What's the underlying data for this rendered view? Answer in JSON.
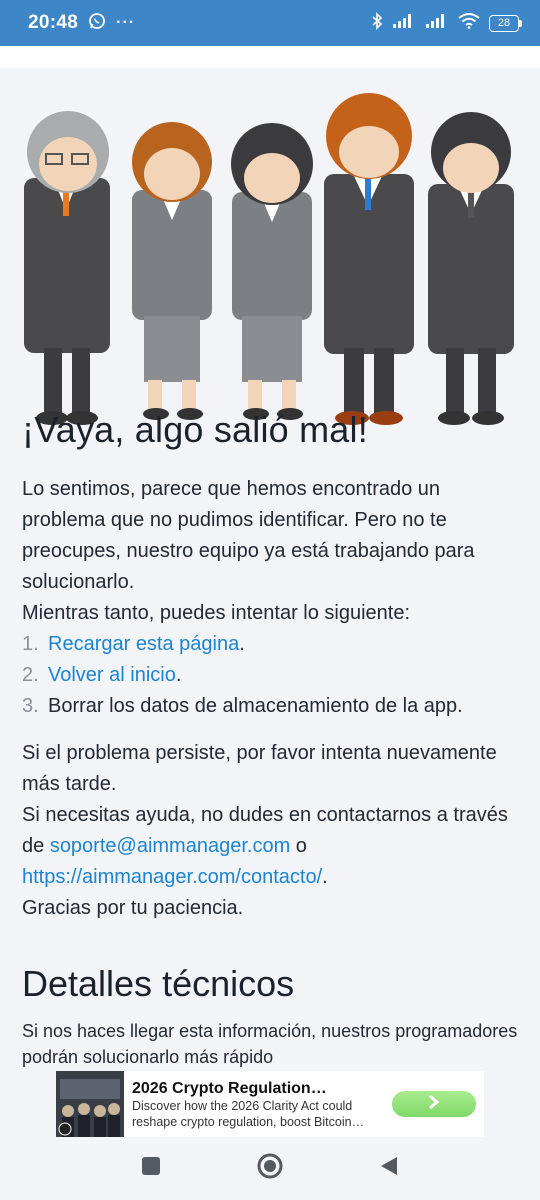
{
  "status_bar": {
    "time": "20:48",
    "more": "···",
    "battery": "28",
    "icons": [
      "whatsapp-icon",
      "bluetooth-icon",
      "signal-icon",
      "signal-icon",
      "wifi-icon",
      "battery-icon"
    ]
  },
  "error_page": {
    "title": "¡Vaya, algo salió mal!",
    "intro": "Lo sentimos, parece que hemos encontrado un problema que no pudimos identificar. Pero no te preocupes, nuestro equipo ya está trabajando para solucionarlo.",
    "meanwhile": "Mientras tanto, puedes intentar lo siguiente:",
    "steps": [
      {
        "num": "1.",
        "text": "Recargar esta página",
        "suffix": "."
      },
      {
        "num": "2.",
        "text": "Volver al inicio",
        "suffix": "."
      },
      {
        "num": "3.",
        "text": "Borrar los datos de almacenamiento de la app.",
        "suffix": ""
      }
    ],
    "persist": "Si el problema persiste, por favor intenta nuevamente más tarde.",
    "help_prefix": "Si necesitas ayuda, no dudes en contactarnos a través de",
    "help_email": "soporte@aimmanager.com",
    "help_or": "o",
    "help_url": "https://aimmanager.com/contacto/",
    "help_end": ".",
    "thanks": "Gracias por tu paciencia.",
    "tech_title": "Detalles técnicos",
    "tech_intro": "Si nos haces llegar esta información, nuestros programadores podrán solucionarlo más rápido"
  },
  "ad": {
    "title": "2026 Crypto Regulation…",
    "description": "Discover how the 2026 Clarity Act could reshape crypto regulation, boost Bitcoin…",
    "cta_icon": "chevron-right-icon"
  },
  "nav_bar": {
    "buttons": [
      "recents-icon",
      "home-icon",
      "back-icon"
    ]
  },
  "colors": {
    "status_bar": "#3d86c8",
    "link": "#1c84d2",
    "background": "#f2f4f8"
  }
}
